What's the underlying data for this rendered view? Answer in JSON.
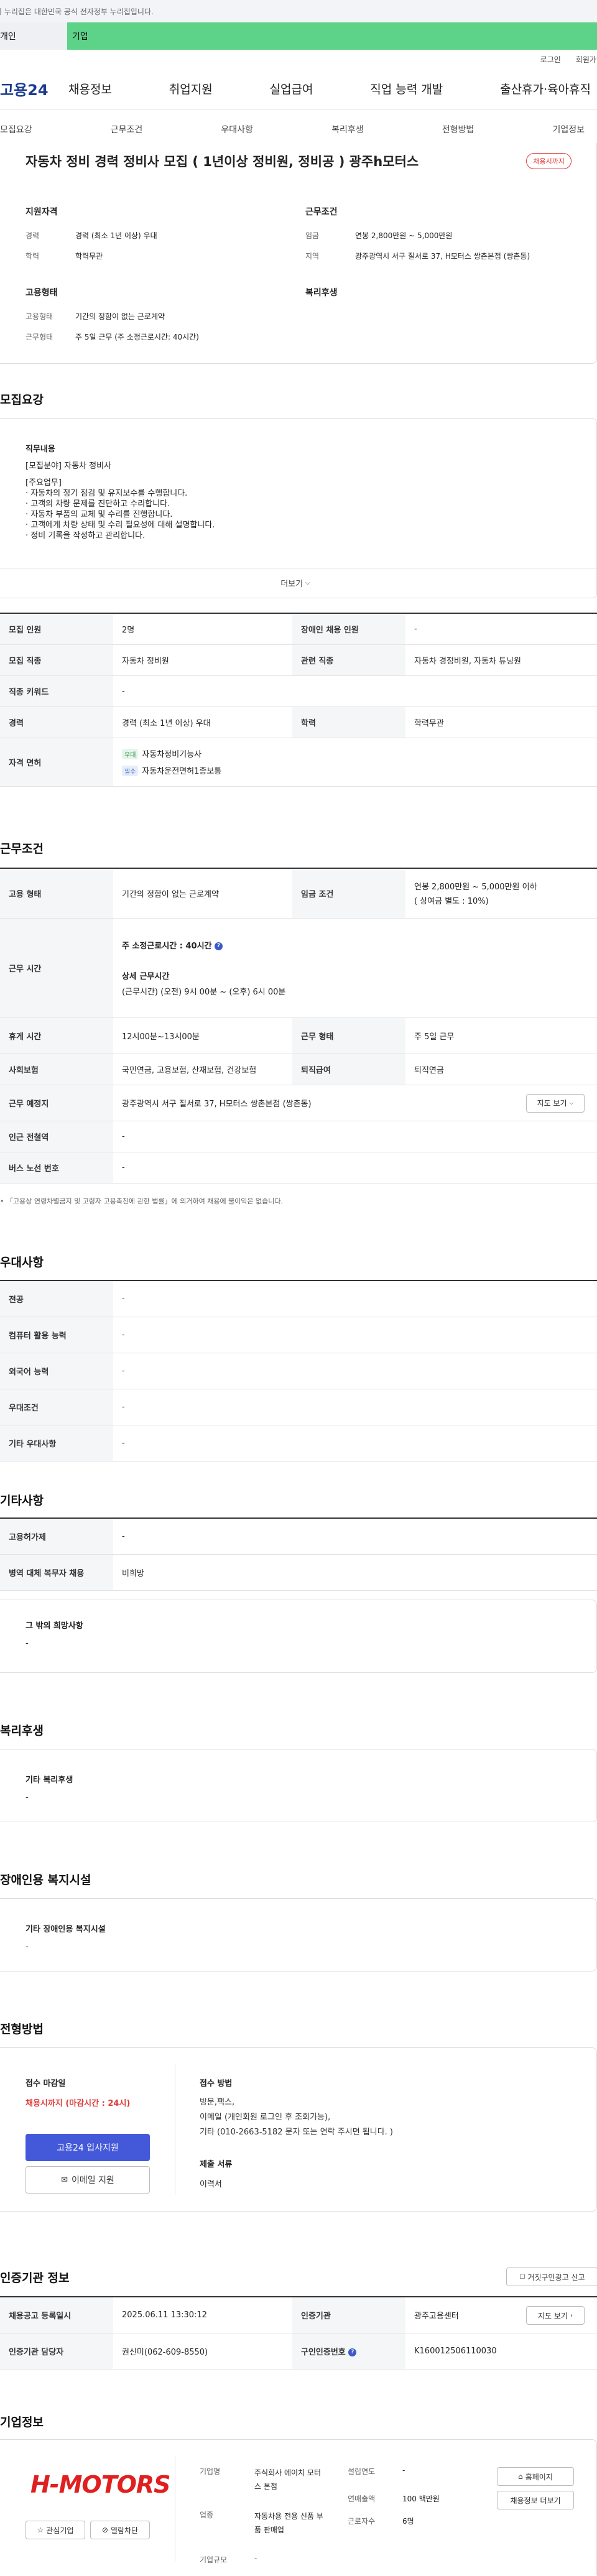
{
  "gov_banner": "이 누리집은 대한민국 공식 전자정부 누리집입니다.",
  "tabs": {
    "personal": "개인",
    "company": "기업"
  },
  "util": {
    "login": "로그인",
    "join": "회원가입"
  },
  "logo": "고용24",
  "gnb": [
    "채용정보",
    "취업지원",
    "실업급여",
    "직업 능력 개발",
    "출산휴가·육아휴직"
  ],
  "subnav": [
    "모집요강",
    "근무조건",
    "우대사항",
    "복리후생",
    "전형방법",
    "기업정보"
  ],
  "job": {
    "title": "자동차 정비 경력 정비사 모집 ( 1년이상 정비원, 정비공 ) 광주h모터스",
    "status": "채용시까지",
    "qualify_title": "지원자격",
    "career_label": "경력",
    "career": "경력 (최소 1년 이상) 우대",
    "edu_label": "학력",
    "edu": "학력무관",
    "cond_title": "근무조건",
    "wage_label": "임금",
    "wage": "연봉 2,800만원 ~ 5,000만원",
    "region_label": "지역",
    "region": "광주광역시 서구 질서로 37, H모터스 쌍촌본점 (쌍촌동)",
    "employ_title": "고용형태",
    "etype_label": "고용형태",
    "etype": "기간의 정함이 없는 근로계약",
    "wtype_label": "근무형태",
    "wtype": "주 5일 근무 (주 소정근로시간: 40시간)",
    "welfare_title": "복리후생"
  },
  "recruit": {
    "title": "모집요강",
    "duty_title": "직무내용",
    "duty_lines": [
      "[모집분야] 자동차 정비사",
      "",
      "[주요업무]",
      "· 자동차의 정기 점검 및 유지보수를 수행합니다.",
      "· 고객의 차량 문제를 진단하고 수리합니다.",
      "· 자동차 부품의 교체 및 수리를 진행합니다.",
      "· 고객에게 차량 상태 및 수리 필요성에 대해 설명합니다.",
      "· 정비 기록을 작성하고 관리합니다."
    ],
    "more": "더보기",
    "rows": [
      {
        "k1": "모집 인원",
        "v1": "2명",
        "k2": "장애인 채용 인원",
        "v2": "-"
      },
      {
        "k1": "모집 직종",
        "v1": "자동차 정비원",
        "k2": "관련 직종",
        "v2": "자동차 경정비원, 자동차 튜닝원"
      },
      {
        "k1": "직종 키워드",
        "v1": "-"
      },
      {
        "k1": "경력",
        "v1": "경력 (최소 1년 이상) 우대",
        "k2": "학력",
        "v2": "학력무관"
      }
    ],
    "license_label": "자격 면허",
    "licenses": [
      {
        "tag": "우대",
        "name": "자동차정비기능사"
      },
      {
        "tag": "필수",
        "name": "자동차운전면허1종보통"
      }
    ]
  },
  "work": {
    "title": "근무조건",
    "etype_label": "고용 형태",
    "etype": "기간의 정함이 없는 근로계약",
    "wage_label": "임금 조건",
    "wage": "연봉 2,800만원 ~ 5,000만원 이하",
    "wage_sub": "( 상여금 별도 : 10%)",
    "hours_label": "근무 시간",
    "hours_week": "주 소정근로시간 : 40시간",
    "hours_detail_title": "상세 근무시간",
    "hours_detail": "(근무시간) (오전) 9시 00분 ~ (오후) 6시 00분",
    "break_label": "휴게 시간",
    "break": "12시00분~13시00분",
    "wform_label": "근무 형태",
    "wform": "주 5일 근무",
    "ins_label": "사회보험",
    "ins": "국민연금, 고용보험, 산재보험, 건강보험",
    "retire_label": "퇴직급여",
    "retire": "퇴직연금",
    "place_label": "근무 예정지",
    "place": "광주광역시 서구 질서로 37, H모터스 쌍촌본점 (쌍촌동)",
    "map_btn": "지도 보기",
    "subway_label": "인근 전철역",
    "subway": "-",
    "bus_label": "버스 노선 번호",
    "bus": "-",
    "note": "「고용상 연령차별금지 및 고령자 고용촉진에 관한 법률」에 의거하여 채용에 불이익은 없습니다."
  },
  "pref": {
    "title": "우대사항",
    "rows": [
      {
        "k": "전공",
        "v": "-"
      },
      {
        "k": "컴퓨터 활용 능력",
        "v": "-"
      },
      {
        "k": "외국어 능력",
        "v": "-"
      },
      {
        "k": "우대조건",
        "v": "-"
      },
      {
        "k": "기타 우대사항",
        "v": "-"
      }
    ]
  },
  "etc": {
    "title": "기타사항",
    "rows": [
      {
        "k": "고용허가제",
        "v": "-"
      },
      {
        "k": "병역 대체 복무자 채용",
        "v": "비희망"
      }
    ],
    "box_title": "그 밖의 희망사항",
    "box_val": "-"
  },
  "welfare": {
    "title": "복리후생",
    "box_title": "기타 복리후생",
    "box_val": "-"
  },
  "disabled": {
    "title": "장애인용 복지시설",
    "box_title": "기타 장애인용 복지시설",
    "box_val": "-"
  },
  "selection": {
    "title": "전형방법",
    "deadline_title": "접수 마감일",
    "deadline": "채용시까지 (마감시간 : 24시)",
    "apply_btn": "고용24 입사지원",
    "email_btn": "이메일 지원",
    "method_title": "접수 방법",
    "method_lines": [
      "방문,팩스,",
      "이메일 (개인회원 로그인 후 조회가능),",
      "기타 (010-2663-5182 문자 또는 연락 주시면 됩니다. )"
    ],
    "docs_title": "제출 서류",
    "docs": "이력서"
  },
  "cert": {
    "title": "인증기관 정보",
    "report_btn": "거짓구인광고 신고",
    "reg_label": "채용공고 등록일시",
    "reg": "2025.06.11 13:30:12",
    "org_label": "인증기관",
    "org": "광주고용센터",
    "map_btn": "지도 보기",
    "mgr_label": "인증기관 담당자",
    "mgr": "권신미(062-609-8550)",
    "no_label": "구인인증번호",
    "no": "K160012506110030"
  },
  "company": {
    "title": "기업정보",
    "logo": "H-MOTORS",
    "interest_btn": "관심기업",
    "block_btn": "열람차단",
    "name_label": "기업명",
    "name": "주식회사 에이치 모터스 본점",
    "year_label": "설립연도",
    "year": "-",
    "ind_label": "업종",
    "ind": "자동차용 전용 신품 부품 판매업",
    "sales_label": "연매출액",
    "sales": "100 백만원",
    "emp_label": "근로자수",
    "emp": "6명",
    "size_label": "기업규모",
    "size": "-",
    "home_btn": "홈페이지",
    "other_btn": "채용정보 더보기"
  }
}
